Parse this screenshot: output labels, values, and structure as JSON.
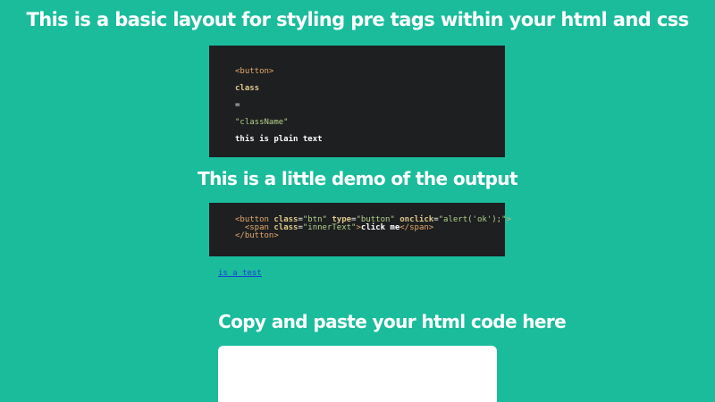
{
  "header": {
    "title": "This is a basic layout for styling pre tags within your html and css"
  },
  "code_block_1": {
    "tag": "<button>",
    "attr": "class",
    "equals": "=",
    "string": "\"className\"",
    "plain": "this is plain text"
  },
  "demo": {
    "title": "This is a little demo of the output"
  },
  "code_block_2": {
    "line1": {
      "open_tag": "<button ",
      "attr1": "class",
      "eq1": "=",
      "val1": "\"btn\"",
      "attr2": " type",
      "eq2": "=",
      "val2": "\"button\"",
      "attr3": " onclick",
      "eq3": "=",
      "val3": "\"alert('ok');\"",
      "close": ">"
    },
    "line2": {
      "indent": "  ",
      "open_tag": "<span ",
      "attr1": "class",
      "eq1": "=",
      "val1": "\"innerText\"",
      "close": ">",
      "text": "click me",
      "end_tag": "</span>"
    },
    "line3": {
      "end_tag": "</button>"
    }
  },
  "demo_link": {
    "label": "is a test"
  },
  "paste": {
    "title": "Copy and paste your html code here",
    "value": ""
  },
  "colors": {
    "background": "#1abc9c",
    "code_background": "#1d1f21",
    "tag": "#e6a96b",
    "attr": "#e0c98a",
    "string": "#b5d38a",
    "link": "#1b3fd6"
  }
}
